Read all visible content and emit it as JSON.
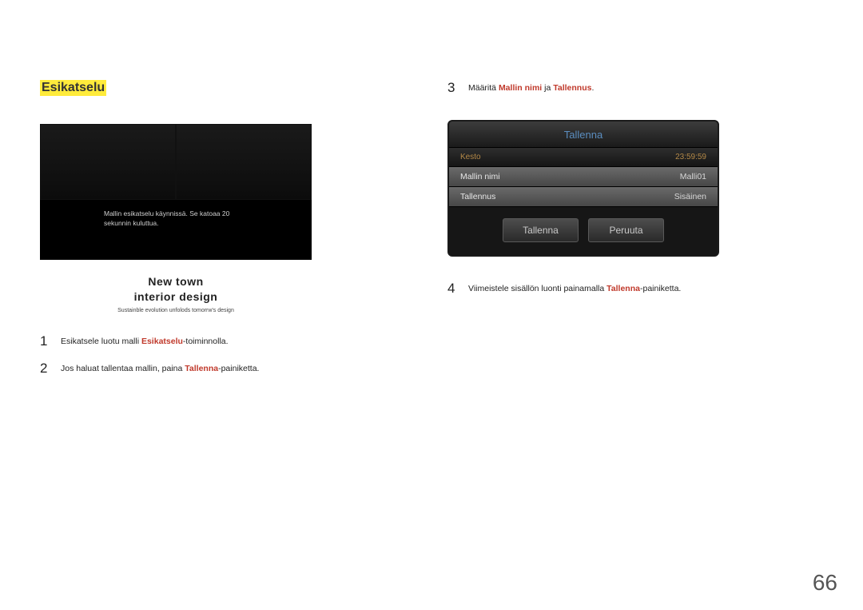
{
  "heading": "Esikatselu",
  "preview_overlay": {
    "line1": "Mallin esikatselu käynnissä. Se katoaa 20",
    "line2": "sekunnin kuluttua."
  },
  "slogan": {
    "line1": "New  town",
    "line2": "interior  design",
    "sub": "Sustainble evolution unfolods tomorrw's design"
  },
  "steps_left": [
    {
      "num": "1",
      "pre": "Esikatsele luotu malli ",
      "hl": "Esikatselu",
      "post": "-toiminnolla."
    },
    {
      "num": "2",
      "pre": "Jos haluat tallentaa mallin, paina ",
      "hl": "Tallenna",
      "post": "-painiketta."
    }
  ],
  "step3": {
    "num": "3",
    "pre": "Määritä ",
    "hl1": "Mallin nimi",
    "mid": " ja ",
    "hl2": "Tallennus",
    "post": "."
  },
  "dialog": {
    "title": "Tallenna",
    "kesto_label": "Kesto",
    "kesto_value": "23:59:59",
    "rows": [
      {
        "label": "Mallin nimi",
        "value": "Malli01"
      },
      {
        "label": "Tallennus",
        "value": "Sisäinen"
      }
    ],
    "save": "Tallenna",
    "cancel": "Peruuta"
  },
  "step4": {
    "num": "4",
    "pre": "Viimeistele sisällön luonti painamalla ",
    "hl": "Tallenna",
    "post": "-painiketta."
  },
  "page_number": "66"
}
